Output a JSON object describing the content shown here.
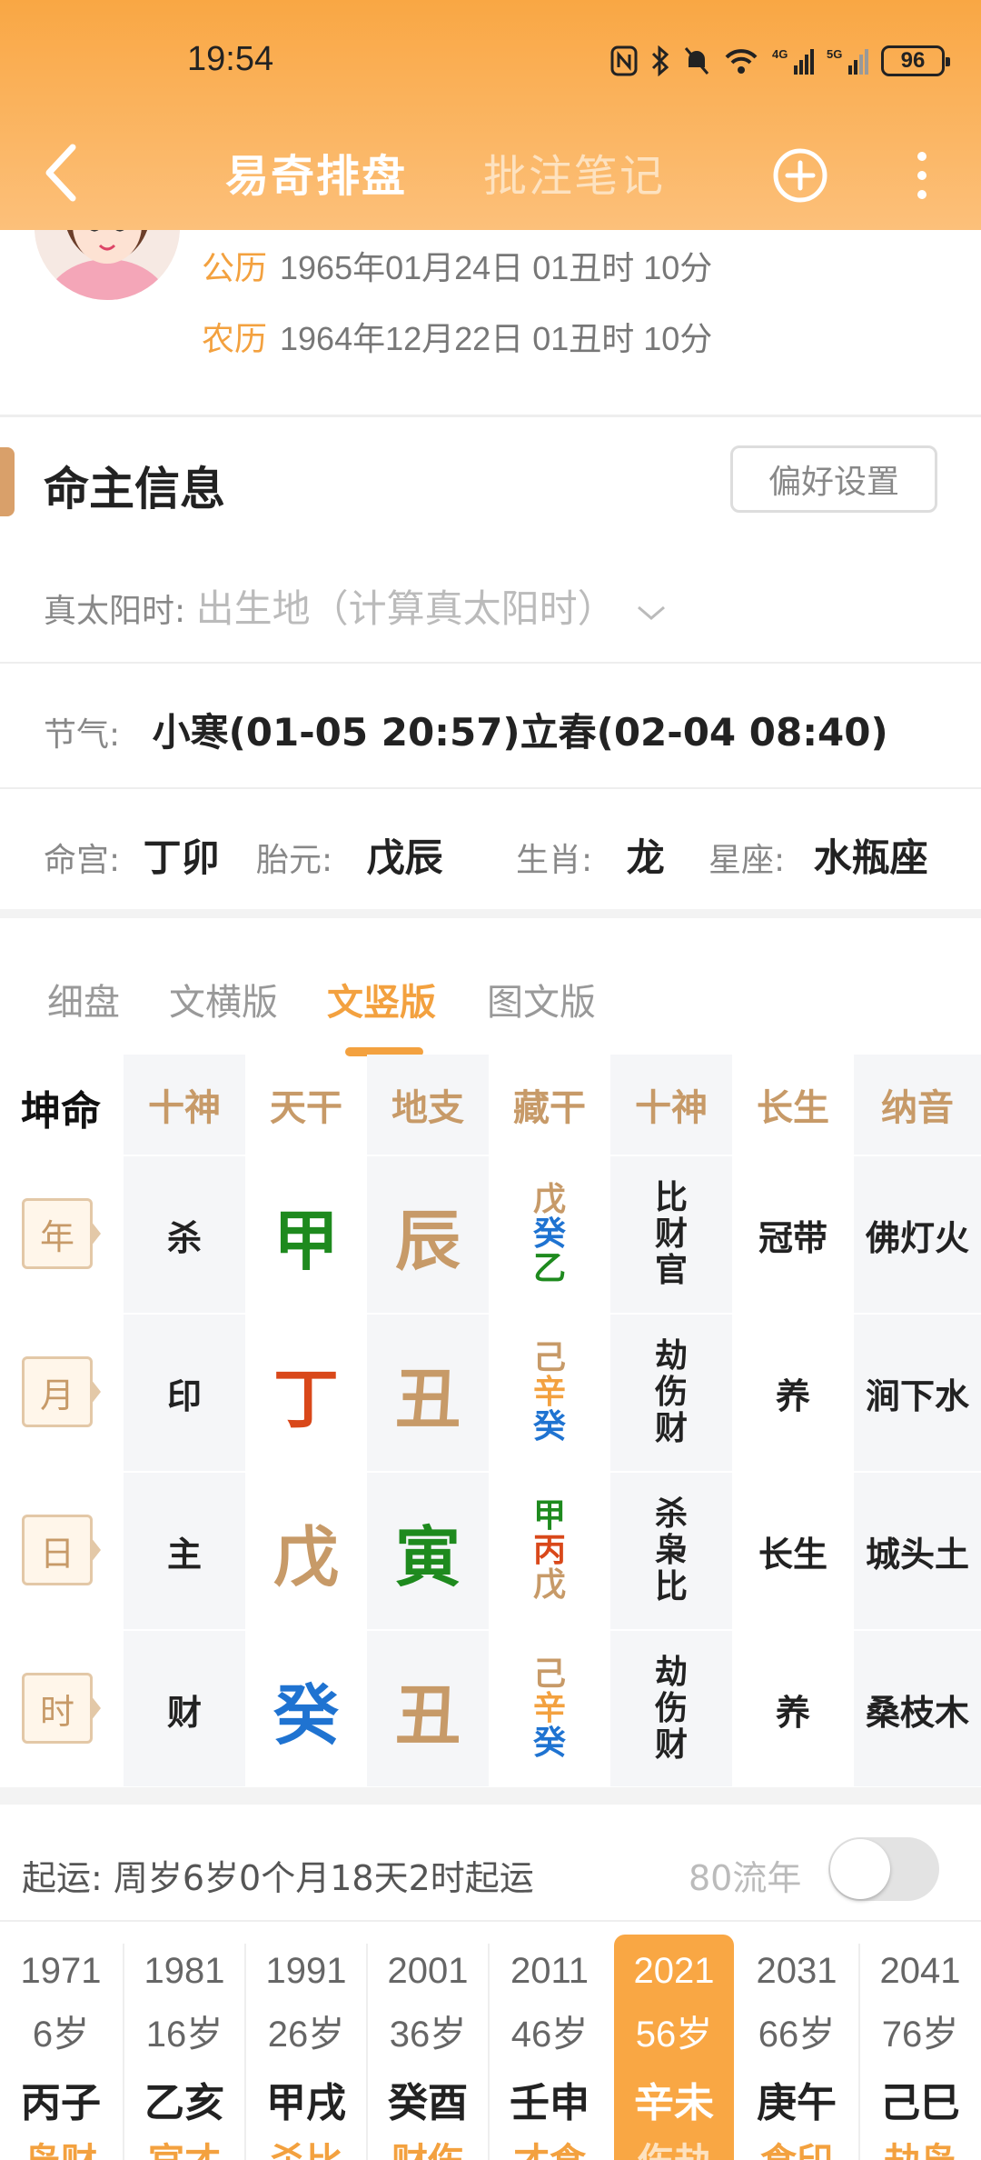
{
  "status_bar": {
    "time": "19:54",
    "battery": "96"
  },
  "nav": {
    "active_tab": "易奇排盘",
    "inactive_tab": "批注笔记"
  },
  "profile": {
    "solar_label": "公历",
    "solar_date": "1965年01月24日 01丑时 10分",
    "lunar_label": "农历",
    "lunar_date": "1964年12月22日 01丑时 10分"
  },
  "section": {
    "title": "命主信息",
    "pref_button": "偏好设置"
  },
  "info": {
    "true_solar_label": "真太阳时:",
    "true_solar_placeholder": "出生地（计算真太阳时）",
    "jieqi_label": "节气:",
    "jieqi_value": "小寒(01-05 20:57)立春(02-04 08:40)",
    "minggong_label": "命宫:",
    "minggong_value": "丁卯",
    "taiyuan_label": "胎元:",
    "taiyuan_value": "戊辰",
    "shengxiao_label": "生肖:",
    "shengxiao_value": "龙",
    "xingzuo_label": "星座:",
    "xingzuo_value": "水瓶座"
  },
  "tabs": [
    "细盘",
    "文横版",
    "文竖版",
    "图文版"
  ],
  "grid": {
    "headers": [
      "坤命",
      "十神",
      "天干",
      "地支",
      "藏干",
      "十神",
      "长生",
      "纳音"
    ],
    "rows": [
      {
        "pillar": "年",
        "shishen": "杀",
        "gan": "甲",
        "zhi": "辰",
        "hidden": [
          "戊",
          "癸",
          "乙"
        ],
        "ten": [
          "比",
          "财",
          "官"
        ],
        "changsheng": "冠带",
        "nayin": "佛灯火"
      },
      {
        "pillar": "月",
        "shishen": "印",
        "gan": "丁",
        "zhi": "丑",
        "hidden": [
          "己",
          "辛",
          "癸"
        ],
        "ten": [
          "劫",
          "伤",
          "财"
        ],
        "changsheng": "养",
        "nayin": "涧下水"
      },
      {
        "pillar": "日",
        "shishen": "主",
        "gan": "戊",
        "zhi": "寅",
        "hidden": [
          "甲",
          "丙",
          "戊"
        ],
        "ten": [
          "杀",
          "枭",
          "比"
        ],
        "changsheng": "长生",
        "nayin": "城头土"
      },
      {
        "pillar": "时",
        "shishen": "财",
        "gan": "癸",
        "zhi": "丑",
        "hidden": [
          "己",
          "辛",
          "癸"
        ],
        "ten": [
          "劫",
          "伤",
          "财"
        ],
        "changsheng": "养",
        "nayin": "桑枝木"
      }
    ]
  },
  "colors": {
    "wood": "#1e8a1e",
    "fire": "#d9481a",
    "earth": "#c79a68",
    "water": "#1f73d1",
    "metal": "#f3a13f",
    "accent": "#f3a13f"
  },
  "qiyun": {
    "label": "起运:  周岁6岁0个月18天2时起运",
    "toggle_label": "80流年",
    "toggle_on": false
  },
  "dayun": [
    {
      "year": "1971",
      "age": "6岁",
      "gz": "丙子",
      "cut": "枭财"
    },
    {
      "year": "1981",
      "age": "16岁",
      "gz": "乙亥",
      "cut": "官才"
    },
    {
      "year": "1991",
      "age": "26岁",
      "gz": "甲戌",
      "cut": "杀比"
    },
    {
      "year": "2001",
      "age": "36岁",
      "gz": "癸酉",
      "cut": "财伤"
    },
    {
      "year": "2011",
      "age": "46岁",
      "gz": "壬申",
      "cut": "才食"
    },
    {
      "year": "2021",
      "age": "56岁",
      "gz": "辛未",
      "cut": "伤劫"
    },
    {
      "year": "2031",
      "age": "66岁",
      "gz": "庚午",
      "cut": "食印"
    },
    {
      "year": "2041",
      "age": "76岁",
      "gz": "己巳",
      "cut": "劫枭"
    }
  ]
}
